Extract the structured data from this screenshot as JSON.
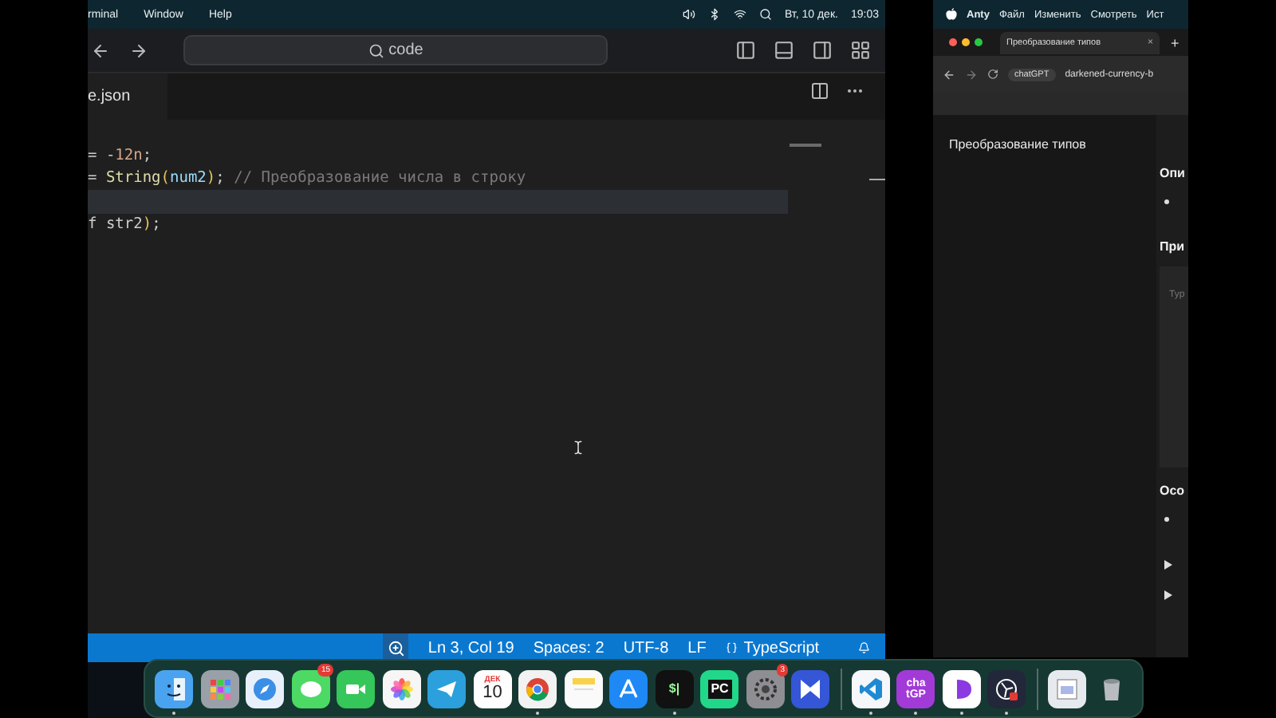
{
  "vscode": {
    "menu_bar": {
      "menus": [
        "rminal",
        "Window",
        "Help"
      ],
      "date": "Вт, 10 дек.",
      "time": "19:03"
    },
    "search": {
      "value": "code"
    },
    "tab": {
      "label": "e.json",
      "selected": true
    },
    "code_lines": [
      {
        "current": false,
        "tokens": [
          {
            "kind": "plain",
            "text": "= -"
          },
          {
            "kind": "number",
            "text": "12n"
          },
          {
            "kind": "plain",
            "text": ";"
          }
        ]
      },
      {
        "current": false,
        "tokens": [
          {
            "kind": "plain",
            "text": "= "
          },
          {
            "kind": "function",
            "text": "String"
          },
          {
            "kind": "paren",
            "text": "("
          },
          {
            "kind": "variable",
            "text": "num2"
          },
          {
            "kind": "paren",
            "text": ")"
          },
          {
            "kind": "plain",
            "text": "; "
          },
          {
            "kind": "comment",
            "text": "// Преобразование числа в строку"
          }
        ]
      },
      {
        "current": true
      },
      {
        "current": false,
        "tokens": [
          {
            "kind": "plain",
            "text": "f str2"
          },
          {
            "kind": "paren",
            "text": ")"
          },
          {
            "kind": "plain",
            "text": ";"
          }
        ]
      }
    ],
    "status_bar": {
      "items": [
        "Ln 3, Col 19",
        "Spaces: 2",
        "UTF-8",
        "LF"
      ],
      "language": "TypeScript"
    }
  },
  "browser": {
    "menu_bar": {
      "app": "Anty",
      "menus": [
        "Файл",
        "Изменить",
        "Смотреть",
        "Ист"
      ]
    },
    "tab": {
      "title": "Преобразование типов",
      "selected": true,
      "close": "×"
    },
    "new_tab": "+",
    "chip": "chatGPT",
    "url": "darkened-currency-b",
    "sidebar_title": "Преобразование типов",
    "blocks": [
      {
        "kind": "heading",
        "text": "Опи"
      },
      {
        "kind": "bullet"
      },
      {
        "kind": "heading",
        "text": "При"
      },
      {
        "kind": "code",
        "placeholder": "Typ"
      },
      {
        "kind": "heading",
        "text": "Осо"
      },
      {
        "kind": "bullet"
      },
      {
        "kind": "disclosure"
      },
      {
        "kind": "disclosure"
      }
    ]
  },
  "dock": {
    "groups": [
      [
        {
          "kind": "finder",
          "running": true
        },
        {
          "kind": "launchpad",
          "running": false
        },
        {
          "kind": "safari",
          "running": false
        },
        {
          "kind": "messages",
          "running": false,
          "badge": "15"
        },
        {
          "kind": "facetime",
          "running": false
        },
        {
          "kind": "photos",
          "running": false
        },
        {
          "kind": "telegram",
          "running": false
        },
        {
          "kind": "calendar",
          "running": false,
          "texts": [
            "ДЕК",
            "10"
          ]
        },
        {
          "kind": "chrome",
          "running": true
        },
        {
          "kind": "notes",
          "running": false
        },
        {
          "kind": "appstore",
          "running": false
        },
        {
          "kind": "terminal",
          "running": true,
          "texts": [
            "$|"
          ]
        },
        {
          "kind": "pycharm",
          "running": false,
          "texts": [
            "PC"
          ]
        },
        {
          "kind": "settings",
          "running": false,
          "badge": "3"
        },
        {
          "kind": "xcross",
          "running": false
        }
      ],
      [
        {
          "kind": "vscode",
          "running": true
        },
        {
          "kind": "chatgpt",
          "running": true,
          "texts": [
            "cha",
            "tGP"
          ]
        },
        {
          "kind": "dia",
          "running": true
        },
        {
          "kind": "obs",
          "running": true
        }
      ],
      [
        {
          "kind": "sheet",
          "running": false
        },
        {
          "kind": "trash",
          "running": false
        }
      ]
    ]
  }
}
